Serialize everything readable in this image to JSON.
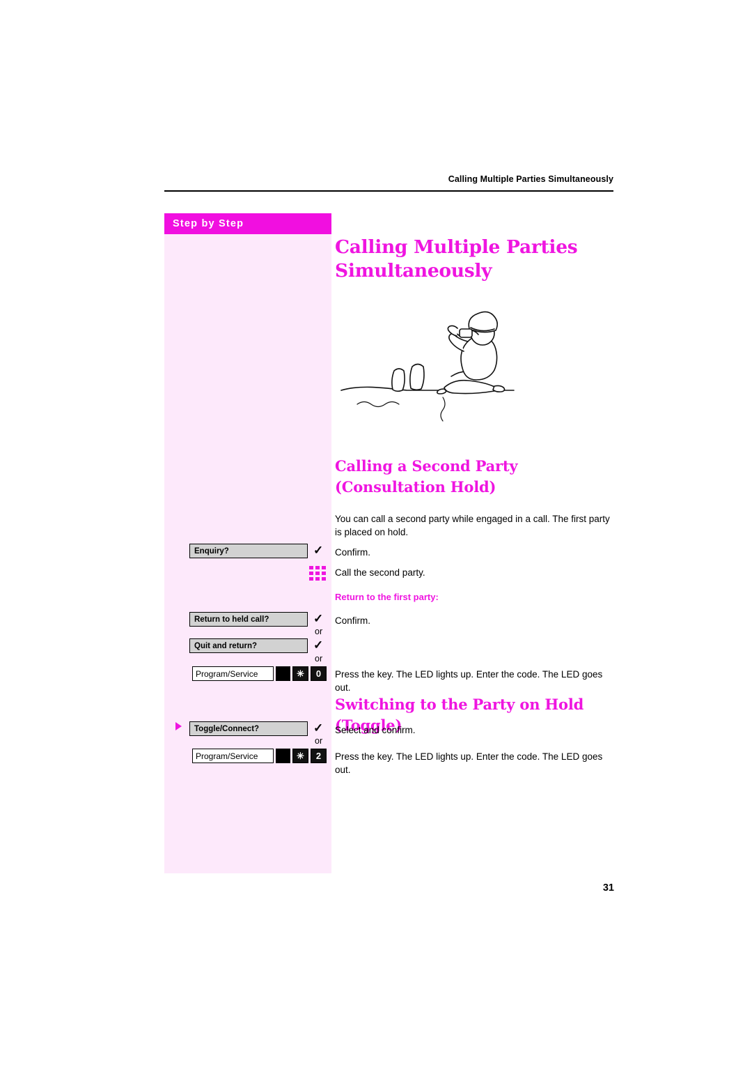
{
  "header": {
    "running_head": "Calling Multiple Parties Simultaneously"
  },
  "sidebar": {
    "title": "Step by Step"
  },
  "main": {
    "title": "Calling Multiple Parties Simultaneously",
    "sections": [
      {
        "heading": "Calling a Second Party (Consultation Hold)",
        "intro": "You can call a second party while engaged in a call. The first party is placed on hold.",
        "lines": [
          "Confirm.",
          "Call the second party."
        ],
        "note": "Return to the first party:",
        "note_lines": [
          "Confirm.",
          "Press the key. The LED lights up. Enter the code. The LED goes out."
        ]
      },
      {
        "heading": "Switching to the Party on Hold (Toggle)",
        "lines": [
          "Select and confirm.",
          "Press the key. The LED lights up. Enter the code. The LED goes out."
        ]
      }
    ]
  },
  "keys": {
    "enquiry": "Enquiry?",
    "return_to_held_call": "Return to held call?",
    "quit_and_return": "Quit and return?",
    "toggle_connect": "Toggle/Connect?",
    "program_service": "Program/Service",
    "or": "or",
    "check_glyph": "✓",
    "star_glyph": "✳",
    "code_digit_0": "0",
    "code_digit_2": "2"
  },
  "footer": {
    "page_number": "31"
  },
  "colors": {
    "accent": "#ef15e0",
    "sidebar_bg": "#fde9fb",
    "sidebar_header_bg": "#f10fe0",
    "key_bg": "#d2d2d2"
  }
}
